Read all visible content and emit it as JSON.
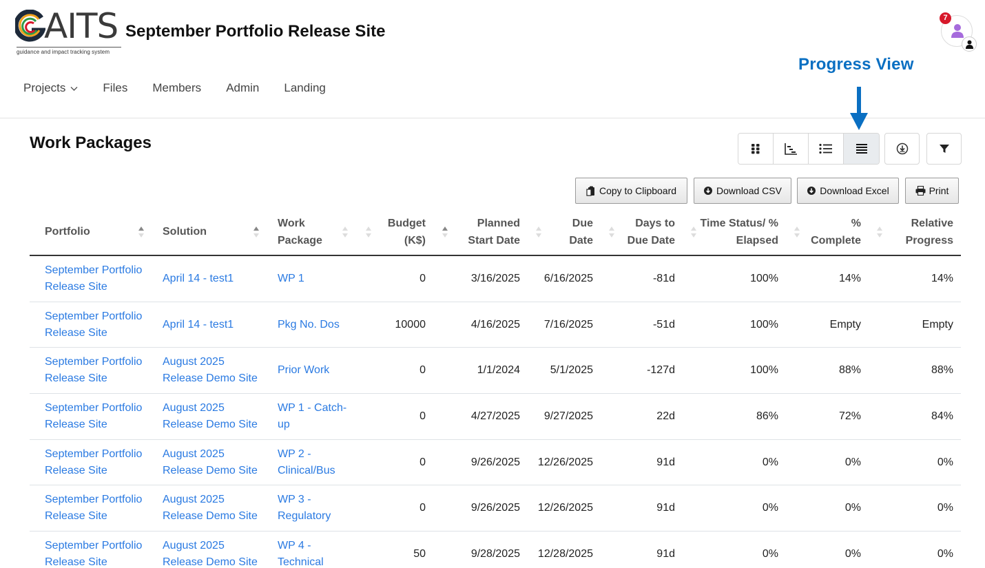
{
  "header": {
    "logo_text_g": "G",
    "logo_text_rest": "AITS",
    "logo_tagline": "guidance and impact tracking system",
    "site_title": "September Portfolio Release Site",
    "notification_count": "7",
    "icons": {
      "avatar": "user-icon",
      "mini_avatar": "user-icon"
    }
  },
  "nav": {
    "items": [
      {
        "label": "Projects",
        "has_dropdown": true
      },
      {
        "label": "Files"
      },
      {
        "label": "Members"
      },
      {
        "label": "Admin"
      },
      {
        "label": "Landing"
      }
    ]
  },
  "annotation": {
    "label": "Progress View",
    "color": "#0a6fc2"
  },
  "page": {
    "title": "Work Packages"
  },
  "view_buttons": [
    {
      "icon": "grid-icon",
      "active": false
    },
    {
      "icon": "gantt-chart-icon",
      "active": false
    },
    {
      "icon": "list-icon",
      "active": false
    },
    {
      "icon": "lines-icon",
      "active": true
    }
  ],
  "tool_buttons": [
    {
      "icon": "download-circle-icon"
    },
    {
      "icon": "filter-icon"
    }
  ],
  "export": {
    "copy": "Copy to Clipboard",
    "csv": "Download CSV",
    "excel": "Download Excel",
    "print": "Print"
  },
  "table": {
    "columns": {
      "portfolio": "Portfolio",
      "solution": "Solution",
      "wp_1": "Work",
      "wp_2": "Package",
      "budget_1": "Budget",
      "budget_2": "(K$)",
      "start_1": "Planned",
      "start_2": "Start Date",
      "due_1": "Due",
      "due_2": "Date",
      "days_1": "Days to",
      "days_2": "Due Date",
      "time_1": "Time Status/ %",
      "time_2": "Elapsed",
      "pct_1": "%",
      "pct_2": "Complete",
      "rel_1": "Relative",
      "rel_2": "Progress"
    },
    "rows": [
      {
        "portfolio_1": "September Portfolio",
        "portfolio_2": "Release Site",
        "solution_1": "April 14 - test1",
        "solution_2": "",
        "wp_1": "WP 1",
        "wp_2": "",
        "budget": "0",
        "start": "3/16/2025",
        "due": "6/16/2025",
        "days": "-81d",
        "time": "100%",
        "pct": "14%",
        "rel": "14%"
      },
      {
        "portfolio_1": "September Portfolio",
        "portfolio_2": "Release Site",
        "solution_1": "April 14 - test1",
        "solution_2": "",
        "wp_1": "Pkg No. Dos",
        "wp_2": "",
        "budget": "10000",
        "start": "4/16/2025",
        "due": "7/16/2025",
        "days": "-51d",
        "time": "100%",
        "pct": "Empty",
        "rel": "Empty"
      },
      {
        "portfolio_1": "September Portfolio",
        "portfolio_2": "Release Site",
        "solution_1": "August 2025",
        "solution_2": "Release Demo Site",
        "wp_1": "Prior Work",
        "wp_2": "",
        "budget": "0",
        "start": "1/1/2024",
        "due": "5/1/2025",
        "days": "-127d",
        "time": "100%",
        "pct": "88%",
        "rel": "88%"
      },
      {
        "portfolio_1": "September Portfolio",
        "portfolio_2": "Release Site",
        "solution_1": "August 2025",
        "solution_2": "Release Demo Site",
        "wp_1": "WP 1 - Catch-",
        "wp_2": "up",
        "budget": "0",
        "start": "4/27/2025",
        "due": "9/27/2025",
        "days": "22d",
        "time": "86%",
        "pct": "72%",
        "rel": "84%"
      },
      {
        "portfolio_1": "September Portfolio",
        "portfolio_2": "Release Site",
        "solution_1": "August 2025",
        "solution_2": "Release Demo Site",
        "wp_1": "WP 2 -",
        "wp_2": "Clinical/Bus",
        "budget": "0",
        "start": "9/26/2025",
        "due": "12/26/2025",
        "days": "91d",
        "time": "0%",
        "pct": "0%",
        "rel": "0%"
      },
      {
        "portfolio_1": "September Portfolio",
        "portfolio_2": "Release Site",
        "solution_1": "August 2025",
        "solution_2": "Release Demo Site",
        "wp_1": "WP 3 -",
        "wp_2": "Regulatory",
        "budget": "0",
        "start": "9/26/2025",
        "due": "12/26/2025",
        "days": "91d",
        "time": "0%",
        "pct": "0%",
        "rel": "0%"
      },
      {
        "portfolio_1": "September Portfolio",
        "portfolio_2": "Release Site",
        "solution_1": "August 2025",
        "solution_2": "Release Demo Site",
        "wp_1": "WP 4 -",
        "wp_2": "Technical",
        "budget": "50",
        "start": "9/28/2025",
        "due": "12/28/2025",
        "days": "91d",
        "time": "0%",
        "pct": "0%",
        "rel": "0%"
      }
    ]
  },
  "colors": {
    "link": "#2a7ae2",
    "badge": "#d7182a",
    "avatar": "#a66bdc"
  }
}
